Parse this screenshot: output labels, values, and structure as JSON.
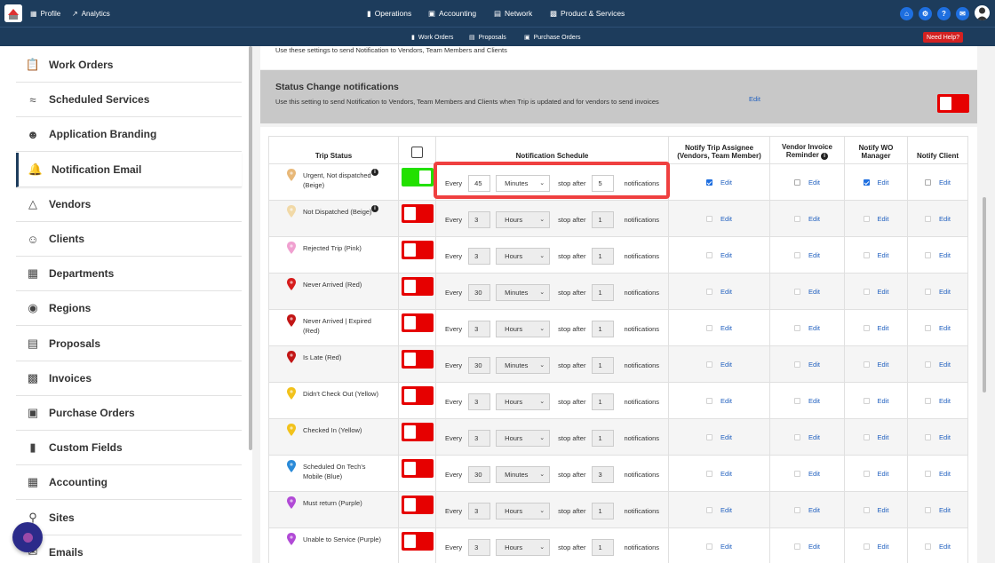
{
  "topnav": {
    "profile": "Profile",
    "analytics": "Analytics",
    "operations": "Operations",
    "accounting": "Accounting",
    "network": "Network",
    "products": "Product & Services"
  },
  "subnav": {
    "work_orders": "Work Orders",
    "proposals": "Proposals",
    "purchase_orders": "Purchase Orders",
    "need_help": "Need Help?"
  },
  "sidebar": {
    "items": [
      {
        "label": "Work Orders",
        "icon": "clipboard-icon"
      },
      {
        "label": "Scheduled Services",
        "icon": "handshake-icon"
      },
      {
        "label": "Application Branding",
        "icon": "people-icon"
      },
      {
        "label": "Notification Email",
        "icon": "bell-icon"
      },
      {
        "label": "Vendors",
        "icon": "hardhat-icon"
      },
      {
        "label": "Clients",
        "icon": "person-icon"
      },
      {
        "label": "Departments",
        "icon": "building-icon"
      },
      {
        "label": "Regions",
        "icon": "globe-icon"
      },
      {
        "label": "Proposals",
        "icon": "proposal-icon"
      },
      {
        "label": "Invoices",
        "icon": "invoice-icon"
      },
      {
        "label": "Purchase Orders",
        "icon": "purchase-order-icon"
      },
      {
        "label": "Custom Fields",
        "icon": "custom-fields-icon"
      },
      {
        "label": "Accounting",
        "icon": "calculator-icon"
      },
      {
        "label": "Sites",
        "icon": "pin-icon"
      },
      {
        "label": "Emails",
        "icon": "envelope-icon"
      }
    ],
    "active": "Notification Email"
  },
  "intro_text": "Use these settings to send Notification to Vendors, Team Members and Clients",
  "status_panel": {
    "title": "Status Change notifications",
    "description": "Use this setting to send Notification to Vendors, Team Members and Clients when Trip is updated and for vendors to send invoices",
    "edit": "Edit",
    "enabled": false
  },
  "table": {
    "headers": {
      "trip_status": "Trip Status",
      "schedule": "Notification Schedule",
      "assignee": "Notify Trip Assignee (Vendors, Team Member)",
      "vendor": "Vendor Invoice Reminder",
      "wo": "Notify WO Manager",
      "client": "Notify Client"
    },
    "labels": {
      "every": "Every",
      "stop_after": "stop after",
      "notifications": "notifications",
      "edit": "Edit"
    },
    "rows": [
      {
        "status": "Urgent, Not dispatched (Beige)",
        "pin_color": "#e8b878",
        "info": true,
        "enabled": true,
        "every": "45",
        "unit": "Minutes",
        "stop": "5",
        "assignee": true,
        "vendor": false,
        "wo": true,
        "client": false
      },
      {
        "status": "Not Dispatched (Beige)",
        "pin_color": "#f1d9a7",
        "info": true,
        "enabled": false,
        "every": "3",
        "unit": "Hours",
        "stop": "1",
        "assignee": false,
        "vendor": false,
        "wo": false,
        "client": false
      },
      {
        "status": "Rejected Trip (Pink)",
        "pin_color": "#f0a0d0",
        "info": false,
        "enabled": false,
        "every": "3",
        "unit": "Hours",
        "stop": "1",
        "assignee": false,
        "vendor": false,
        "wo": false,
        "client": false
      },
      {
        "status": "Never Arrived (Red)",
        "pin_color": "#d61c1c",
        "info": false,
        "enabled": false,
        "every": "30",
        "unit": "Minutes",
        "stop": "1",
        "assignee": false,
        "vendor": false,
        "wo": false,
        "client": false
      },
      {
        "status": "Never Arrived | Expired (Red)",
        "pin_color": "#c21616",
        "info": false,
        "enabled": false,
        "every": "3",
        "unit": "Hours",
        "stop": "1",
        "assignee": false,
        "vendor": false,
        "wo": false,
        "client": false
      },
      {
        "status": "Is Late (Red)",
        "pin_color": "#c21616",
        "info": false,
        "enabled": false,
        "every": "30",
        "unit": "Minutes",
        "stop": "1",
        "assignee": false,
        "vendor": false,
        "wo": false,
        "client": false
      },
      {
        "status": "Didn't Check Out (Yellow)",
        "pin_color": "#f2c21b",
        "info": false,
        "enabled": false,
        "every": "3",
        "unit": "Hours",
        "stop": "1",
        "assignee": false,
        "vendor": false,
        "wo": false,
        "client": false
      },
      {
        "status": "Checked In (Yellow)",
        "pin_color": "#f2c21b",
        "info": false,
        "enabled": false,
        "every": "3",
        "unit": "Hours",
        "stop": "1",
        "assignee": false,
        "vendor": false,
        "wo": false,
        "client": false
      },
      {
        "status": "Scheduled On Tech's Mobile (Blue)",
        "pin_color": "#2a8ad8",
        "info": false,
        "enabled": false,
        "every": "30",
        "unit": "Minutes",
        "stop": "3",
        "assignee": false,
        "vendor": false,
        "wo": false,
        "client": false
      },
      {
        "status": "Must return (Purple)",
        "pin_color": "#b14ad6",
        "info": false,
        "enabled": false,
        "every": "3",
        "unit": "Hours",
        "stop": "1",
        "assignee": false,
        "vendor": false,
        "wo": false,
        "client": false
      },
      {
        "status": "Unable to Service (Purple)",
        "pin_color": "#b14ad6",
        "info": false,
        "enabled": false,
        "every": "3",
        "unit": "Hours",
        "stop": "1",
        "assignee": false,
        "vendor": false,
        "wo": false,
        "client": false
      }
    ]
  },
  "colors": {
    "nav": "#1d3c5c",
    "toggle_on": "#22e000",
    "toggle_off": "#e60000",
    "highlight": "#ef4040",
    "link": "#1f5fbf"
  }
}
